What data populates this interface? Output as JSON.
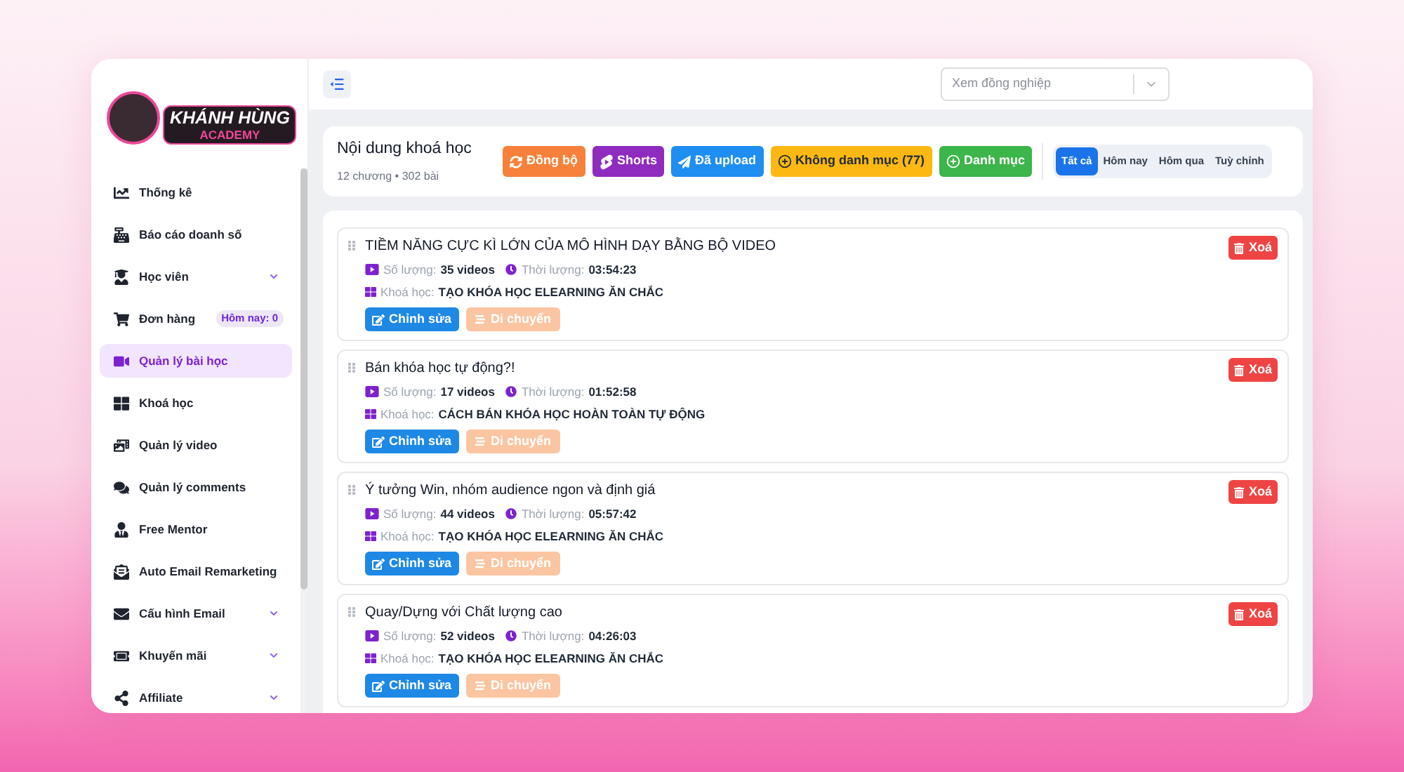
{
  "logo": {
    "name": "KHÁNH HÙNG",
    "tagline": "ACADEMY"
  },
  "sidebar": {
    "items": [
      {
        "label": "Thống kê",
        "selected": false,
        "expandable": false
      },
      {
        "label": "Báo cáo doanh số",
        "selected": false,
        "expandable": false
      },
      {
        "label": "Học viên",
        "selected": false,
        "expandable": true
      },
      {
        "label": "Đơn hàng",
        "selected": false,
        "expandable": false,
        "badge": "Hôm nay: 0"
      },
      {
        "label": "Quản lý bài học",
        "selected": true,
        "expandable": false
      },
      {
        "label": "Khoá học",
        "selected": false,
        "expandable": false
      },
      {
        "label": "Quản lý video",
        "selected": false,
        "expandable": false
      },
      {
        "label": "Quản lý comments",
        "selected": false,
        "expandable": false
      },
      {
        "label": "Free Mentor",
        "selected": false,
        "expandable": false
      },
      {
        "label": "Auto Email Remarketing",
        "selected": false,
        "expandable": false
      },
      {
        "label": "Cấu hình Email",
        "selected": false,
        "expandable": true
      },
      {
        "label": "Khuyến mãi",
        "selected": false,
        "expandable": true
      },
      {
        "label": "Affiliate",
        "selected": false,
        "expandable": true
      }
    ]
  },
  "header": {
    "colleague_select": {
      "placeholder": "Xem đồng nghiệp"
    }
  },
  "summary": {
    "title": "Nội dung khoá học",
    "subtitle": "12 chương • 302 bài",
    "actions": [
      {
        "label": "Đồng bộ",
        "color": "#f7813a"
      },
      {
        "label": "Shorts",
        "color": "#8f2bbf"
      },
      {
        "label": "Đã upload",
        "color": "#1f8ef1"
      },
      {
        "label": "Không danh mục (77)",
        "color": "#fdb813"
      },
      {
        "label": "Danh mục",
        "color": "#3cb54a"
      }
    ],
    "filter_tabs": [
      {
        "label": "Tất cả",
        "selected": true
      },
      {
        "label": "Hôm nay",
        "selected": false
      },
      {
        "label": "Hôm qua",
        "selected": false
      },
      {
        "label": "Tuỳ chỉnh",
        "selected": false
      }
    ]
  },
  "lessons": [
    {
      "title": "TIỀM NĂNG CỰC KÌ LỚN CỦA MÔ HÌNH DẠY BẰNG BỘ VIDEO",
      "count_label": "Số lượng:",
      "count": "35 videos",
      "duration_label": "Thời lượng:",
      "duration": "03:54:23",
      "course_label": "Khoá học:",
      "course": "TẠO KHÓA HỌC ELEARNING ĂN CHẮC",
      "edit_label": "Chỉnh sửa",
      "move_label": "Di chuyển",
      "move_disabled": true,
      "delete_label": "Xoá"
    },
    {
      "title": "Bán khóa học tự động?!",
      "count_label": "Số lượng:",
      "count": "17 videos",
      "duration_label": "Thời lượng:",
      "duration": "01:52:58",
      "course_label": "Khoá học:",
      "course": "CÁCH BÁN KHÓA HỌC HOÀN TOÀN TỰ ĐỘNG",
      "edit_label": "Chỉnh sửa",
      "move_label": "Di chuyển",
      "move_disabled": true,
      "delete_label": "Xoá"
    },
    {
      "title": "Ý tưởng Win, nhóm audience ngon và định giá",
      "count_label": "Số lượng:",
      "count": "44 videos",
      "duration_label": "Thời lượng:",
      "duration": "05:57:42",
      "course_label": "Khoá học:",
      "course": "TẠO KHÓA HỌC ELEARNING ĂN CHẮC",
      "edit_label": "Chỉnh sửa",
      "move_label": "Di chuyển",
      "move_disabled": true,
      "delete_label": "Xoá"
    },
    {
      "title": "Quay/Dựng với Chất lượng cao",
      "count_label": "Số lượng:",
      "count": "52 videos",
      "duration_label": "Thời lượng:",
      "duration": "04:26:03",
      "course_label": "Khoá học:",
      "course": "TẠO KHÓA HỌC ELEARNING ĂN CHẮC",
      "edit_label": "Chỉnh sửa",
      "move_label": "Di chuyển",
      "move_disabled": true,
      "delete_label": "Xoá"
    }
  ]
}
